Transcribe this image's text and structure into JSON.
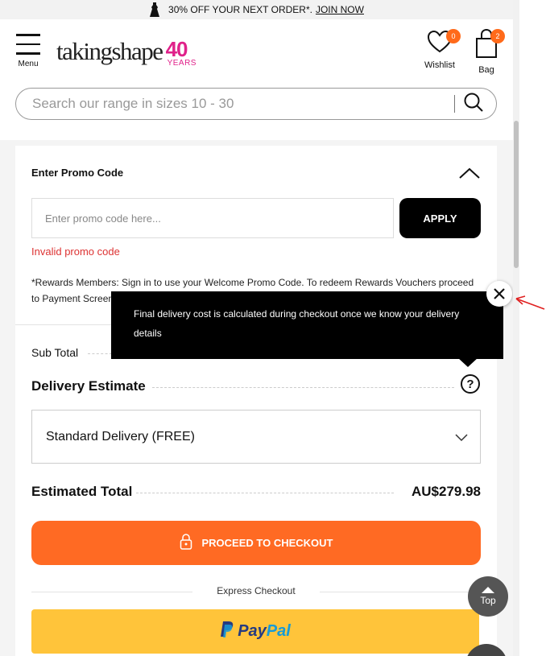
{
  "promo_bar": {
    "text": "30% OFF YOUR NEXT ORDER*.",
    "link": "JOIN NOW",
    "icon": "dress-icon"
  },
  "header": {
    "menu_label": "Menu",
    "brand": "takingshape",
    "anniversary_number": "40",
    "anniversary_label": "YEARS",
    "wishlist_label": "Wishlist",
    "wishlist_count": "0",
    "bag_label": "Bag",
    "bag_count": "2"
  },
  "search": {
    "placeholder": "Search our range in sizes 10 - 30",
    "value": ""
  },
  "promo": {
    "title": "Enter Promo Code",
    "placeholder": "Enter promo code here...",
    "value": "",
    "apply_label": "APPLY",
    "error": "Invalid promo code",
    "rewards_note": "*Rewards Members: Sign in to use your Welcome Promo Code. To redeem Rewards Vouchers proceed to Payment Screen."
  },
  "summary": {
    "subtotal_label": "Sub Total",
    "delivery_title": "Delivery Estimate",
    "delivery_option": "Standard Delivery (FREE)",
    "estimated_total_label": "Estimated Total",
    "estimated_total_value": "AU$279.98"
  },
  "checkout": {
    "proceed_label": "PROCEED TO CHECKOUT",
    "express_label": "Express Checkout",
    "paypal_pay": "Pay",
    "paypal_pal": "Pal"
  },
  "tooltip": {
    "text": "Final delivery cost is calculated during checkout once we know your delivery details"
  },
  "top_button": {
    "label": "Top"
  },
  "colors": {
    "accent": "#ff6a23",
    "badge": "#ff6a1a",
    "brand_pink": "#e0218a",
    "error": "#d33333",
    "paypal": "#ffc43a"
  }
}
